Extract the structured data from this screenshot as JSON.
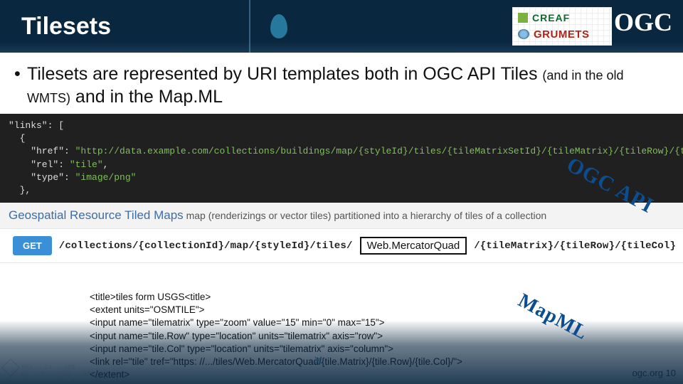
{
  "header": {
    "title": "Tilesets",
    "logo1": "CREAF",
    "logo2": "GRUMETS",
    "ogc": "OGC"
  },
  "bullet": {
    "line_a": "Tilesets are represented by URI templates both in OGC API Tiles ",
    "line_b_small": "(and in the old WMTS)",
    "line_c": " and in the Map.ML"
  },
  "code_json": {
    "l1": "\"links\": [",
    "l2": "  {",
    "l3_k": "    \"href\": ",
    "l3_v": "\"http://data.example.com/collections/buildings/map/{styleId}/tiles/{tileMatrixSetId}/{tileMatrix}/{tileRow}/{tileCol}.png\"",
    "l4_k": "    \"rel\": ",
    "l4_v": "\"tile\"",
    "l5_k": "    \"type\": ",
    "l5_v": "\"image/png\"",
    "l6": "  },"
  },
  "desc": {
    "title": "Geospatial Resource Tiled Maps",
    "rest": "  map (renderizings or vector tiles) partitioned into a hierarchy of tiles of a collection"
  },
  "api": {
    "method": "GET",
    "path_pre": "/collections/{collectionId}/map/{styleId}/tiles/",
    "wm": "Web.MercatorQuad",
    "path_post": "/{tileMatrix}/{tileRow}/{tileCol}"
  },
  "stamps": {
    "ogc_api": "OGC API",
    "mapml": "MapML"
  },
  "mapml_snippet": {
    "l1": "<title>tiles form USGS<title>",
    "l2": "<extent units=\"OSMTILE\">",
    "l3": "    <input name=\"tilematrix\" type=\"zoom\" value=\"15\" min=\"0\" max=\"15\">",
    "l4": "    <input name=\"tile.Row\" type=\"location\" units=\"tilematrix\" axis=\"row\">",
    "l5": "    <input name=\"tile.Col\" type=\"location\" units=\"tilematrix\" axis=\"column\">",
    "l6": "    <link rel=\"tile\" tref=\"https: //.../tiles/Web.MercatorQuad/{tile.Matrix}/{tile.Row}/{tile.Col}/\">",
    "l7": "</extent>"
  },
  "footer": {
    "deco": "MAX - 24 · 685\nKL - T · 367C · 905",
    "right": "ogc.org 10"
  }
}
